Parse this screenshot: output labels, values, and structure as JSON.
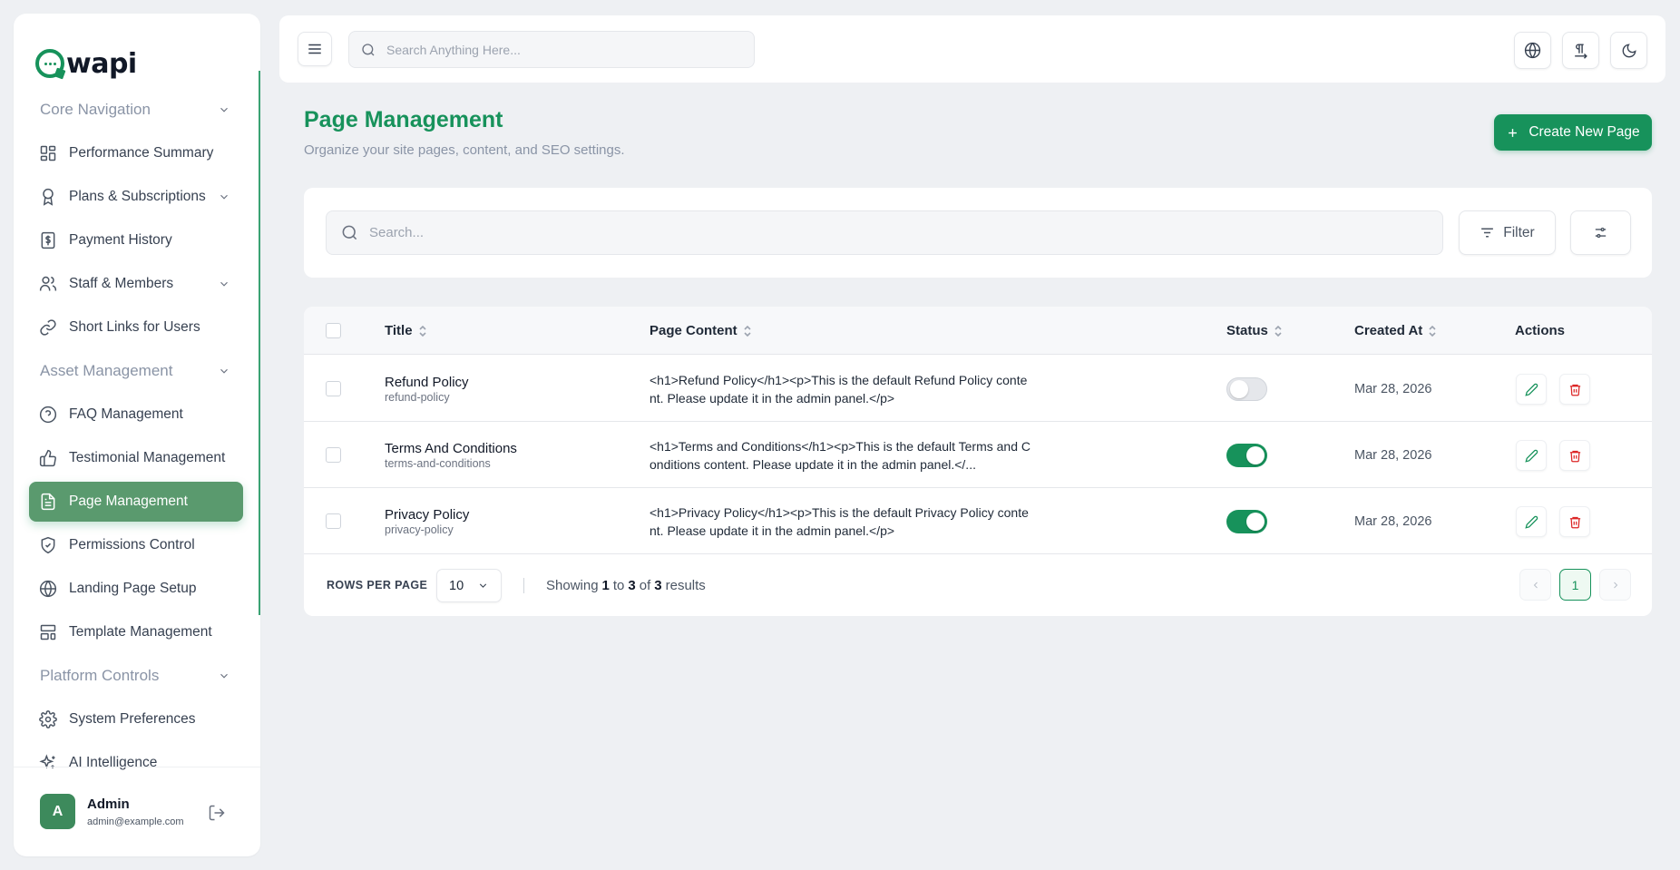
{
  "brand": {
    "name": "wapi",
    "color": "#17925b"
  },
  "sidebar": {
    "groups": [
      {
        "label": "Core Navigation"
      },
      {
        "label": "Asset Management"
      },
      {
        "label": "Platform Controls"
      }
    ],
    "items": [
      {
        "label": "Performance Summary",
        "icon": "dashboard-icon"
      },
      {
        "label": "Plans & Subscriptions",
        "icon": "award-icon"
      },
      {
        "label": "Payment History",
        "icon": "dollar-receipt-icon"
      },
      {
        "label": "Staff & Members",
        "icon": "users-icon"
      },
      {
        "label": "Short Links for Users",
        "icon": "link-icon"
      },
      {
        "label": "FAQ Management",
        "icon": "help-circle-icon"
      },
      {
        "label": "Testimonial Management",
        "icon": "thumbs-up-icon"
      },
      {
        "label": "Page Management",
        "icon": "file-text-icon",
        "active": true
      },
      {
        "label": "Permissions Control",
        "icon": "shield-check-icon"
      },
      {
        "label": "Landing Page Setup",
        "icon": "globe-icon"
      },
      {
        "label": "Template Management",
        "icon": "layout-template-icon"
      },
      {
        "label": "System Preferences",
        "icon": "gear-icon"
      },
      {
        "label": "AI Intelligence",
        "icon": "sparkles-icon"
      }
    ],
    "user": {
      "initial": "A",
      "name": "Admin",
      "email": "admin@example.com"
    }
  },
  "topbar": {
    "search_placeholder": "Search Anything Here..."
  },
  "header": {
    "title": "Page Management",
    "subtitle": "Organize your site pages, content, and SEO settings.",
    "create_label": "Create New Page"
  },
  "filters": {
    "search_placeholder": "Search...",
    "filter_label": "Filter"
  },
  "table": {
    "columns": {
      "title": "Title",
      "content": "Page Content",
      "status": "Status",
      "created": "Created At",
      "actions": "Actions"
    },
    "rows": [
      {
        "title": "Refund Policy",
        "slug": "refund-policy",
        "content": "<h1>Refund Policy</h1><p>This is the default Refund Policy content. Please update it in the admin panel.</p>",
        "status": false,
        "created": "Mar 28, 2026"
      },
      {
        "title": "Terms And Conditions",
        "slug": "terms-and-conditions",
        "content": "<h1>Terms and Conditions</h1><p>This is the default Terms and Conditions content. Please update it in the admin panel.</...",
        "status": true,
        "created": "Mar 28, 2026"
      },
      {
        "title": "Privacy Policy",
        "slug": "privacy-policy",
        "content": "<h1>Privacy Policy</h1><p>This is the default Privacy Policy content. Please update it in the admin panel.</p>",
        "status": true,
        "created": "Mar 28, 2026"
      }
    ]
  },
  "footer": {
    "rows_per_page_label": "ROWS PER PAGE",
    "rows_per_page": "10",
    "showing_prefix": "Showing",
    "from": "1",
    "to_word": "to",
    "to": "3",
    "of_word": "of",
    "total": "3",
    "suffix": "results",
    "current_page": "1"
  }
}
